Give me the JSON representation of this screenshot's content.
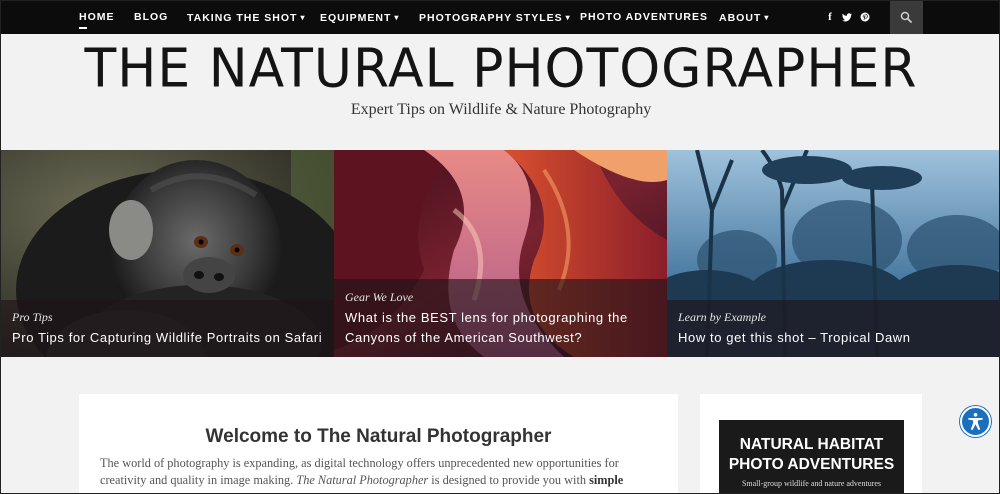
{
  "nav": {
    "items": [
      {
        "label": "HOME",
        "dropdown": false
      },
      {
        "label": "BLOG",
        "dropdown": false
      },
      {
        "label": "TAKING THE SHOT",
        "dropdown": true
      },
      {
        "label": "EQUIPMENT",
        "dropdown": true
      },
      {
        "label": "PHOTOGRAPHY STYLES",
        "dropdown": true
      },
      {
        "label": "PHOTO ADVENTURES",
        "dropdown": false
      },
      {
        "label": "ABOUT",
        "dropdown": true
      }
    ],
    "social": [
      {
        "icon": "facebook-icon",
        "glyph": "f"
      },
      {
        "icon": "twitter-icon",
        "glyph": "🐦"
      },
      {
        "icon": "pinterest-icon",
        "glyph": "ⓟ"
      }
    ],
    "search_icon": "search-icon",
    "chevron": "⌄"
  },
  "header": {
    "title": "THE NATURAL PHOTOGRAPHER",
    "tagline": "Expert Tips on Wildlife & Nature Photography"
  },
  "features": [
    {
      "category": "Pro Tips",
      "title": "Pro Tips for Capturing Wildlife Portraits on Safari"
    },
    {
      "category": "Gear We Love",
      "title": "What is the BEST lens for photographing the Canyons of the American Southwest?"
    },
    {
      "category": "Learn by Example",
      "title": "How to get this shot – Tropical Dawn"
    }
  ],
  "main": {
    "heading": "Welcome to The Natural Photographer",
    "intro_part1": "The world of photography is expanding, as digital technology offers unprecedented new opportunities for creativity and quality in image making. ",
    "intro_em": "The Natural Photographer",
    "intro_part2": " is designed to provide you with ",
    "intro_bold": "simple yet"
  },
  "sidebar": {
    "ad_title_line1": "NATURAL HABITAT",
    "ad_title_line2": "PHOTO ADVENTURES",
    "ad_subtitle": "Small-group wildlife and nature adventures"
  },
  "accessibility": {
    "icon": "accessibility-icon"
  },
  "colors": {
    "nav_bg": "#0c0c0c",
    "page_bg": "#f2f2f2",
    "accessibility_blue": "#1b6fbf"
  }
}
